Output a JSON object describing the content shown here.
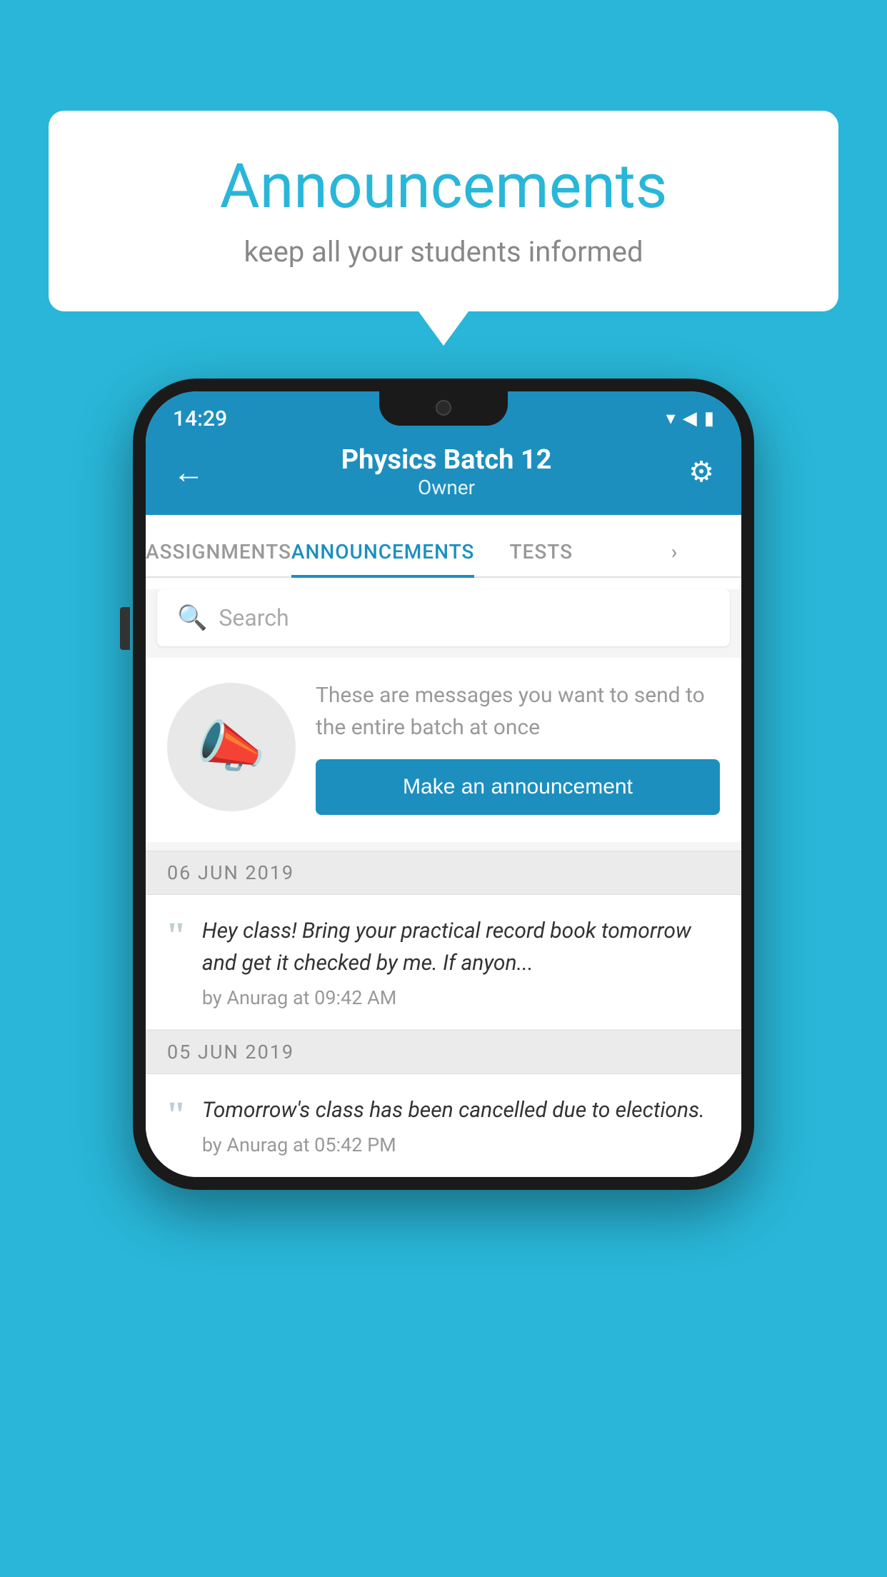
{
  "page": {
    "background_color": "#29b6d8"
  },
  "speech_bubble": {
    "title": "Announcements",
    "subtitle": "keep all your students informed"
  },
  "status_bar": {
    "time": "14:29",
    "signal_icon": "▼◀▮",
    "wifi": "▾",
    "signal": "◀",
    "battery": "▮"
  },
  "app_bar": {
    "back_icon": "←",
    "title": "Physics Batch 12",
    "subtitle": "Owner",
    "settings_icon": "⚙"
  },
  "tabs": [
    {
      "label": "ASSIGNMENTS",
      "active": false
    },
    {
      "label": "ANNOUNCEMENTS",
      "active": true
    },
    {
      "label": "TESTS",
      "active": false
    },
    {
      "label": "",
      "active": false
    }
  ],
  "search": {
    "placeholder": "Search",
    "search_icon": "🔍"
  },
  "promo": {
    "description_text": "These are messages you want to send to the entire batch at once",
    "button_label": "Make an announcement"
  },
  "announcements": [
    {
      "date": "06  JUN  2019",
      "text": "Hey class! Bring your practical record book tomorrow and get it checked by me. If anyon...",
      "meta": "by Anurag at 09:42 AM"
    },
    {
      "date": "05  JUN  2019",
      "text": "Tomorrow's class has been cancelled due to elections.",
      "meta": "by Anurag at 05:42 PM"
    }
  ]
}
